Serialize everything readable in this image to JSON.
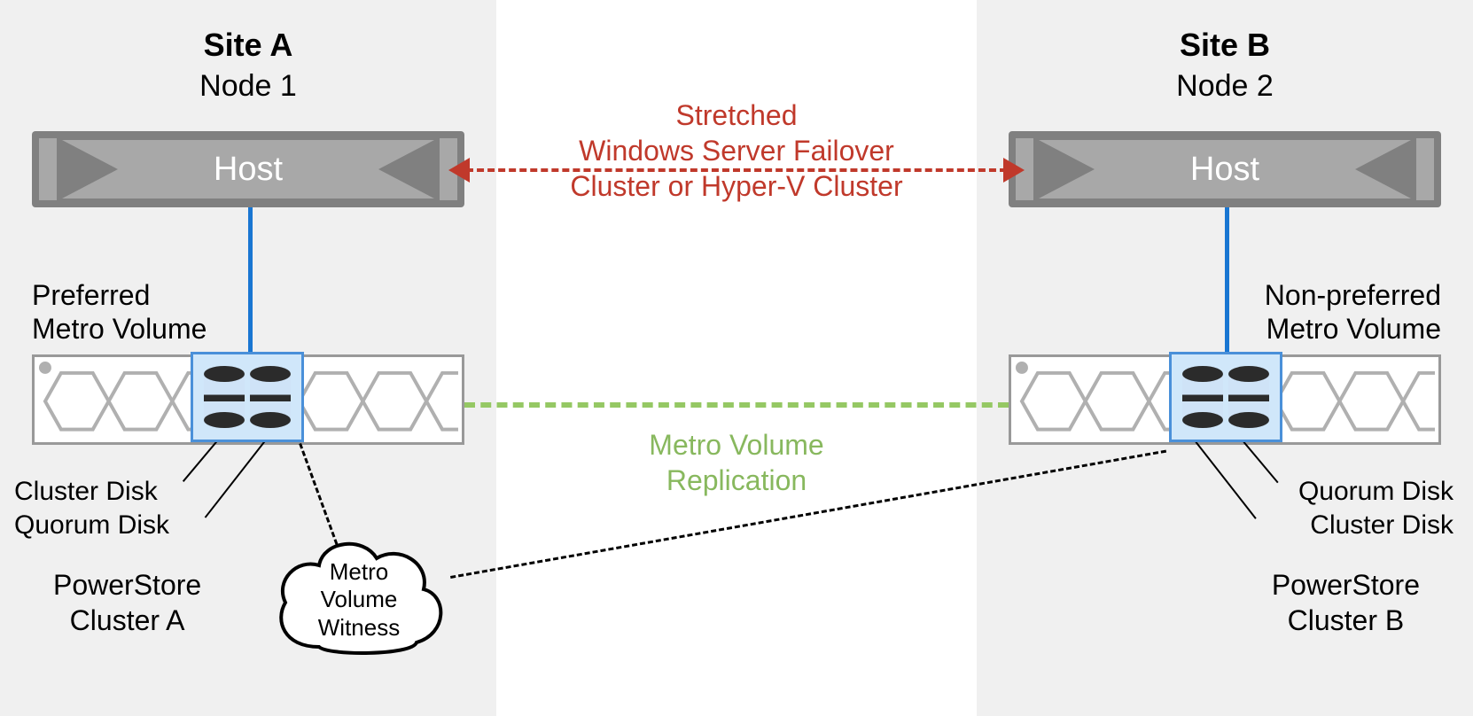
{
  "siteA": {
    "title": "Site A",
    "node": "Node 1",
    "host": "Host",
    "volumeText1": "Preferred",
    "volumeText2": "Metro Volume",
    "diskLabel1": "Cluster Disk",
    "diskLabel2": "Quorum Disk",
    "clusterLabel1": "PowerStore",
    "clusterLabel2": "Cluster A"
  },
  "siteB": {
    "title": "Site B",
    "node": "Node 2",
    "host": "Host",
    "volumeText1": "Non-preferred",
    "volumeText2": "Metro Volume",
    "diskLabel1": "Quorum Disk",
    "diskLabel2": "Cluster Disk",
    "clusterLabel1": "PowerStore",
    "clusterLabel2": "Cluster B"
  },
  "center": {
    "redLine1": "Stretched",
    "redLine2": "Windows Server Failover",
    "redLine3": "Cluster or Hyper-V Cluster",
    "greenLine1": "Metro Volume",
    "greenLine2": "Replication"
  },
  "witness": {
    "line1": "Metro",
    "line2": "Volume",
    "line3": "Witness"
  }
}
